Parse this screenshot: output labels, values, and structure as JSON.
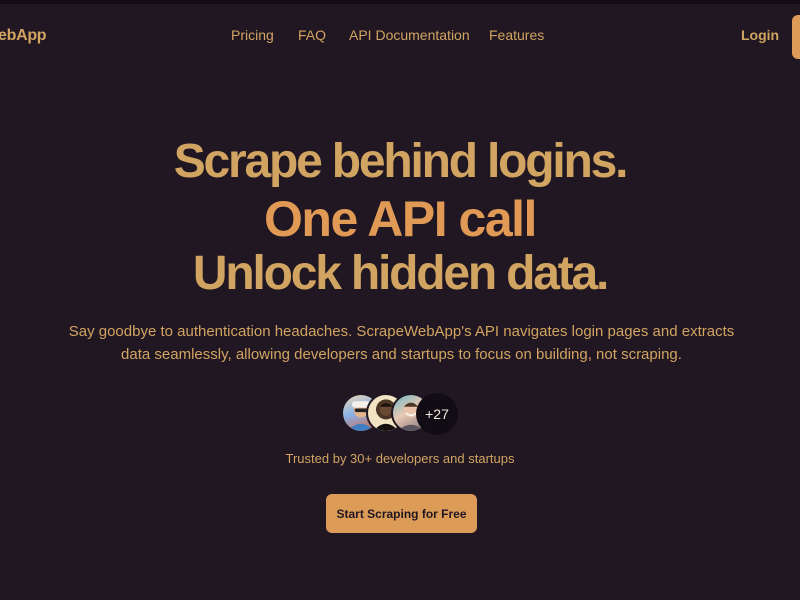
{
  "header": {
    "logo_text": "ebApp",
    "nav": [
      "Pricing",
      "FAQ",
      "API Documentation",
      "Features"
    ],
    "login_label": "Login"
  },
  "hero": {
    "line1": "Scrape behind logins.",
    "line2": "One API call",
    "line3": "Unlock hidden data.",
    "subtitle": "Say goodbye to authentication headaches. ScrapeWebApp's API navigates login pages and extracts data seamlessly, allowing developers and startups to focus on building, not scraping.",
    "avatars_more": "+27",
    "trusted": "Trusted by 30+ developers and startups",
    "cta_label": "Start Scraping for Free"
  },
  "colors": {
    "background": "#201722",
    "accent_gold": "#d2a461",
    "accent_orange": "#e09a55",
    "button": "#dc9b56"
  }
}
